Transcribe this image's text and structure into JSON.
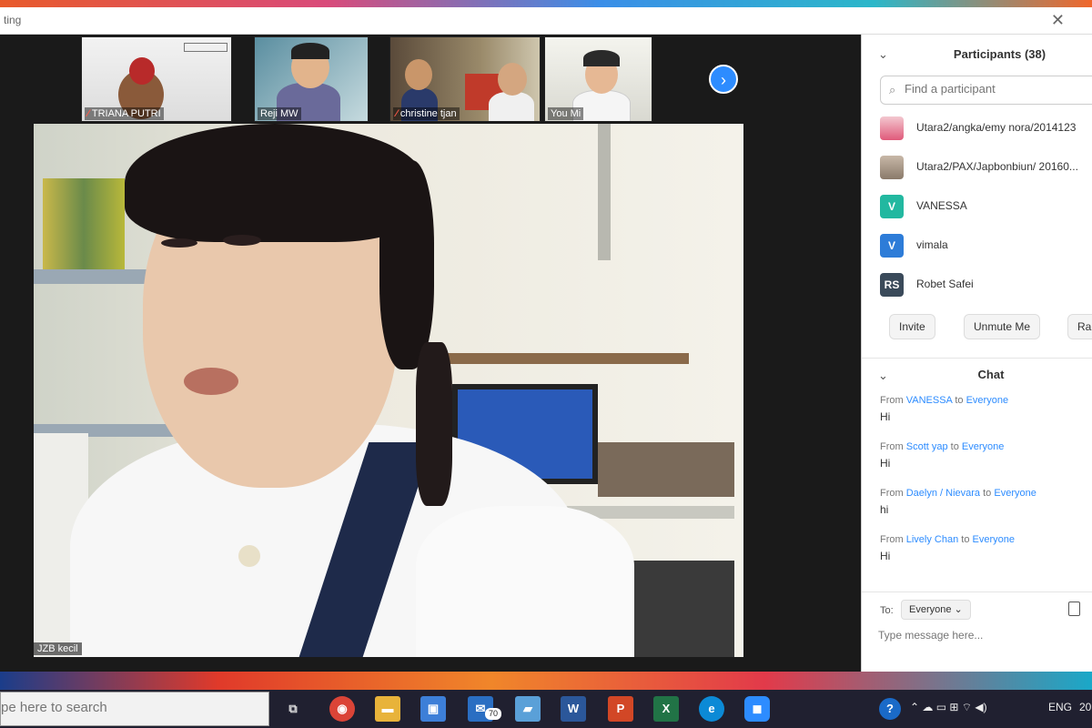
{
  "window": {
    "title": "ting"
  },
  "thumbnails": [
    {
      "name": "TRIANA PUTRI",
      "muted": true
    },
    {
      "name": "Reji MW",
      "muted": false
    },
    {
      "name": "christine tjan",
      "muted": true
    },
    {
      "name": "You Mi",
      "muted": false
    }
  ],
  "main_video": {
    "name": "JZB kecil"
  },
  "participants": {
    "title": "Participants (38)",
    "search_placeholder": "Find a participant",
    "list": [
      {
        "name": "Utara2/angka/emy nora/2014123",
        "avatar": "photo"
      },
      {
        "name": "Utara2/PAX/Japbonbiun/ 20160...",
        "avatar": "photo"
      },
      {
        "name": "VANESSA",
        "avatar": "V",
        "color": "#22b8a0"
      },
      {
        "name": "vimala",
        "avatar": "V",
        "color": "#2d7cd8"
      },
      {
        "name": "Robet Safei",
        "avatar": "RS",
        "color": "#3a4a5a"
      }
    ],
    "buttons": {
      "invite": "Invite",
      "unmute": "Unmute Me",
      "raise": "Raise"
    }
  },
  "chat": {
    "title": "Chat",
    "from_word": "From",
    "to_word": "to",
    "messages": [
      {
        "from": "VANESSA",
        "to": "Everyone",
        "text": "Hi"
      },
      {
        "from": "Scott yap",
        "to": "Everyone",
        "text": "Hi"
      },
      {
        "from": "Daelyn / Nievara",
        "to": "Everyone",
        "text": "hi"
      },
      {
        "from": "Lively Chan",
        "to": "Everyone",
        "text": "Hi"
      }
    ],
    "compose": {
      "to_label": "To:",
      "to_value": "Everyone ⌄",
      "placeholder": "Type message here..."
    }
  },
  "taskbar": {
    "search_placeholder": "pe here to search",
    "mail_badge": "70",
    "icons": [
      {
        "name": "task-view",
        "glyph": "⧉",
        "color": "transparent"
      },
      {
        "name": "chrome",
        "glyph": "◉",
        "color": "#db4437"
      },
      {
        "name": "file-explorer",
        "glyph": "▬",
        "color": "#e8b33a"
      },
      {
        "name": "store",
        "glyph": "▣",
        "color": "#3d7fd8"
      },
      {
        "name": "mail",
        "glyph": "✉",
        "color": "#2a6ec2"
      },
      {
        "name": "notes",
        "glyph": "▰",
        "color": "#5aa0d8"
      },
      {
        "name": "word",
        "glyph": "W",
        "color": "#2b579a"
      },
      {
        "name": "powerpoint",
        "glyph": "P",
        "color": "#d24726"
      },
      {
        "name": "excel",
        "glyph": "X",
        "color": "#217346"
      },
      {
        "name": "edge",
        "glyph": "e",
        "color": "#0c8ad6"
      },
      {
        "name": "zoom",
        "glyph": "◼",
        "color": "#2d8cff"
      }
    ],
    "tray": {
      "lang": "ENG",
      "clock": "20"
    }
  }
}
